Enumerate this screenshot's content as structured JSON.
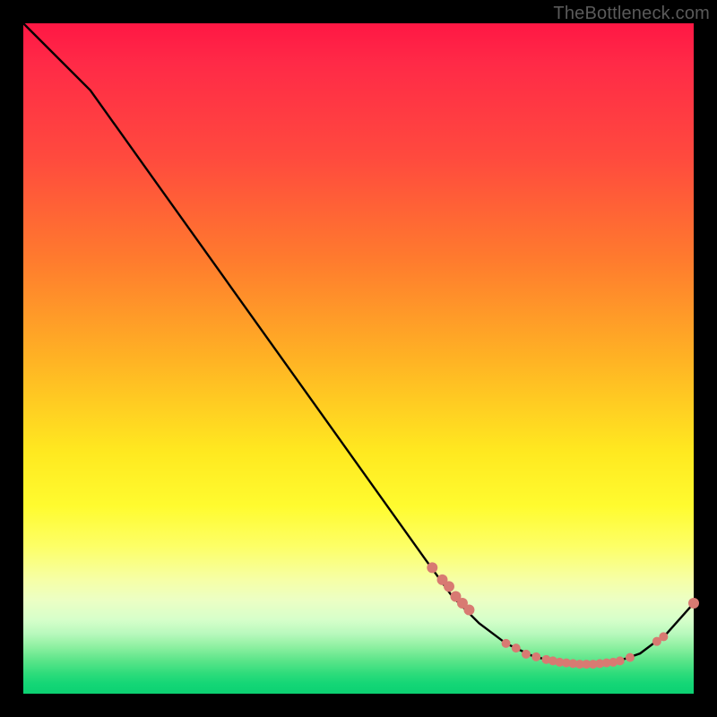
{
  "watermark": "TheBottleneck.com",
  "chart_data": {
    "type": "line",
    "title": "",
    "xlabel": "",
    "ylabel": "",
    "xlim": [
      0,
      100
    ],
    "ylim": [
      0,
      100
    ],
    "grid": false,
    "legend": false,
    "series": [
      {
        "name": "bottleneck-curve",
        "color": "#000000",
        "x": [
          0,
          6,
          10,
          20,
          30,
          40,
          50,
          60,
          64,
          68,
          72,
          76,
          80,
          84,
          88,
          92,
          96,
          100
        ],
        "y": [
          100,
          94,
          90,
          76,
          62,
          48,
          34,
          20,
          14.5,
          10.5,
          7.5,
          5.6,
          4.6,
          4.4,
          4.6,
          6.0,
          9.0,
          13.5
        ]
      }
    ],
    "markers": {
      "name": "highlight-points",
      "color": "#d87a72",
      "radius_primary": 6,
      "radius_secondary": 5,
      "x": [
        61,
        62.5,
        63.5,
        64.5,
        65.5,
        66.5,
        72,
        73.5,
        75,
        76.5,
        78,
        79,
        80,
        81,
        82,
        83,
        84,
        85,
        86,
        87,
        88,
        89,
        90.5,
        94.5,
        95.5,
        100
      ],
      "y": [
        18.8,
        17.0,
        16.0,
        14.5,
        13.5,
        12.5,
        7.5,
        6.8,
        5.9,
        5.5,
        5.1,
        4.9,
        4.7,
        4.6,
        4.5,
        4.4,
        4.4,
        4.4,
        4.5,
        4.6,
        4.7,
        4.9,
        5.4,
        7.8,
        8.5,
        13.5
      ]
    }
  }
}
